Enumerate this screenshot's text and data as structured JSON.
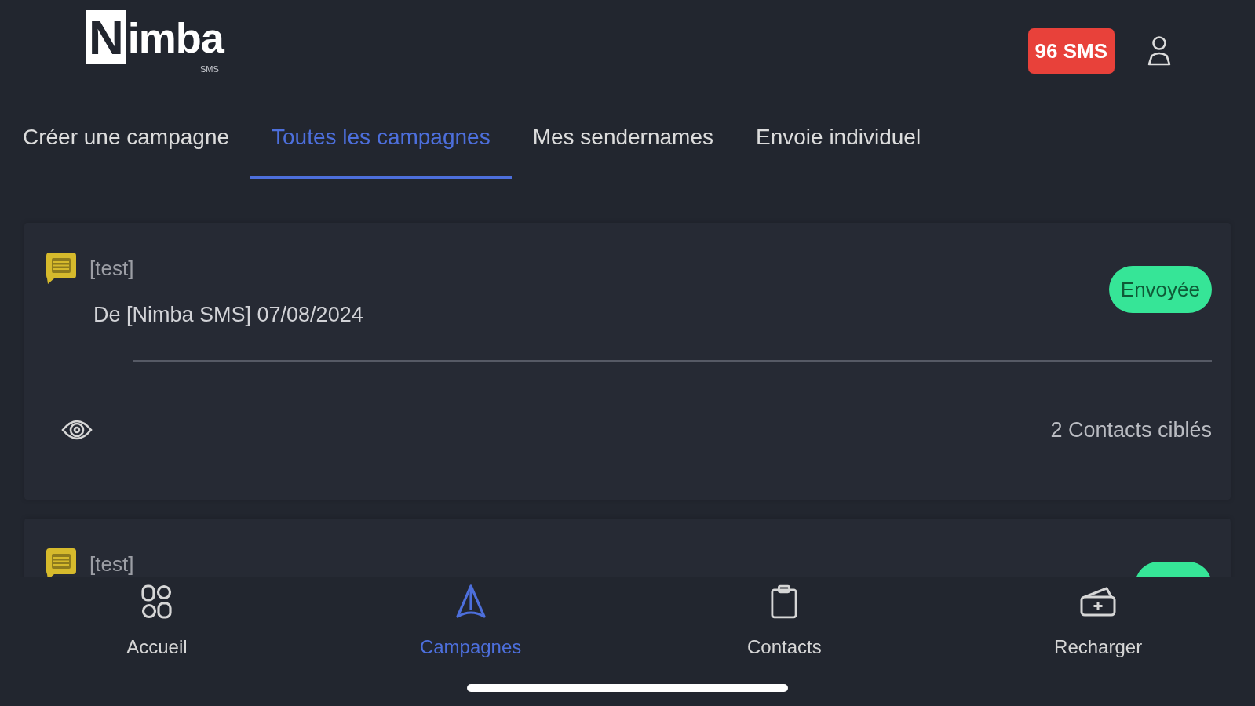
{
  "header": {
    "logo": {
      "initial": "N",
      "rest": "imba",
      "subtitle": "SMS"
    },
    "sms_badge": "96 SMS"
  },
  "tabs": [
    {
      "label": "Créer une campagne",
      "selected": false
    },
    {
      "label": "Toutes les campagnes",
      "selected": true
    },
    {
      "label": "Mes sendernames",
      "selected": false
    },
    {
      "label": "Envoie individuel",
      "selected": false
    }
  ],
  "campaigns": [
    {
      "title": "[test]",
      "sender_line": "De [Nimba SMS] 07/08/2024",
      "status": {
        "label": "Envoyée",
        "kind": "sent"
      },
      "contacts": "2 Contacts ciblés"
    },
    {
      "title": "[test]",
      "status": {
        "kind": "sent"
      }
    }
  ],
  "bottom_nav": [
    {
      "label": "Accueil",
      "selected": false
    },
    {
      "label": "Campagnes",
      "selected": true
    },
    {
      "label": "Contacts",
      "selected": false
    },
    {
      "label": "Recharger",
      "selected": false
    }
  ]
}
